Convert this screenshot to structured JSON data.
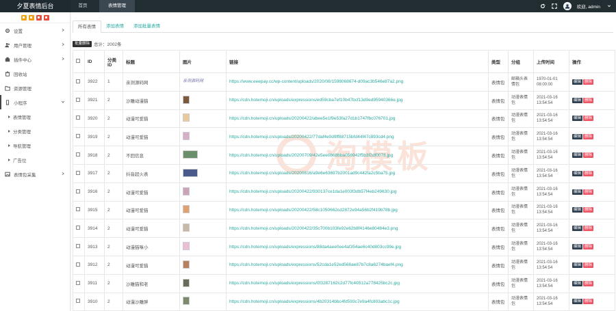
{
  "brand": "夕夏表情后台",
  "nav": {
    "home": "首页",
    "emoji_manage": "表情管理"
  },
  "user": {
    "greeting": "欢迎, admin"
  },
  "colors": {
    "topbar": "#222d32",
    "accent": "#27a9a0",
    "delete": "#ed5565",
    "edit": "#2f4050"
  },
  "quick_buttons": [
    {
      "icon": "home-icon",
      "color": "#f0a30a"
    },
    {
      "icon": "user-icon",
      "color": "#f39c12"
    },
    {
      "icon": "trash-icon",
      "color": "#e74c3c"
    },
    {
      "icon": "gear-icon",
      "color": "#e74c3c"
    }
  ],
  "sidebar": {
    "items": [
      {
        "label": "设置",
        "icon": "gear-icon",
        "has_children": true
      },
      {
        "label": "用户管理",
        "icon": "users-icon",
        "has_children": true
      },
      {
        "label": "插件中心",
        "icon": "plugin-icon",
        "has_children": true
      },
      {
        "label": "回收站",
        "icon": "trash-icon",
        "has_children": false
      },
      {
        "label": "资源管理",
        "icon": "folder-icon",
        "has_children": false
      },
      {
        "label": "小程序",
        "icon": "miniapp-icon",
        "has_children": true
      }
    ],
    "sub_items": [
      "表情管理",
      "分类管理",
      "导航管理",
      "广告位"
    ],
    "last_item": {
      "label": "表情包采集",
      "icon": "image-icon",
      "has_children": true
    }
  },
  "tabs": [
    "所有表情",
    "添加表情",
    "添加批量表情"
  ],
  "toolbar": {
    "batch_delete": "批量删除",
    "total": "总计：2002条"
  },
  "table": {
    "headers": [
      "",
      "ID",
      "分类ID",
      "标题",
      "图片",
      "链接",
      "类型",
      "分组",
      "上传时间",
      "操作"
    ],
    "edit_label": "编辑",
    "delete_label": "删除",
    "rows": [
      {
        "id": "3922",
        "cat": "1",
        "title": "亲测源码网",
        "link": "https://www.eeepay.cc/wp-content/uploads/2020/08/1598068674-d09ac3b546e87a2.png",
        "type": "表情包",
        "group": "邮箱头表情包",
        "time": "1970-01-01 08:00:00",
        "img": "sig",
        "img_text": "亲测源码网",
        "img_color": "#ffffff"
      },
      {
        "id": "3921",
        "cat": "2",
        "title": "沙雕动漫猫",
        "link": "https://cdn.hotemoji.cn/uploads/expressions/ed59cba7ef10b47bcf13d9ed95940366e.jpg",
        "type": "表情包",
        "group": "动漫表情包",
        "time": "2021-03-16 13:54:54",
        "img": "thumb",
        "img_color": "#7a5a3c"
      },
      {
        "id": "3920",
        "cat": "2",
        "title": "动漫可爱猫",
        "link": "https://cdn.hotemoji.cn/uploads/20200422/abee5e1f9e53fa27d1b1747fbc076701.jpg",
        "type": "表情包",
        "group": "动漫表情包",
        "time": "2021-03-16 13:54:54",
        "img": "thumb",
        "img_color": "#e8c9a0"
      },
      {
        "id": "3919",
        "cat": "2",
        "title": "动漫可爱猫",
        "link": "https://cdn.hotemoji.cn/uploads/20200422/77daf4e0d9ff88715bfd44f47c893cd4.png",
        "type": "表情包",
        "group": "动漫表情包",
        "time": "2021-03-16 13:54:54",
        "img": "thumb",
        "img_color": "#d7b0c8"
      },
      {
        "id": "3918",
        "cat": "2",
        "title": "不回信息",
        "link": "https://cdn.hotemoji.cn/uploads/20200709/42e5ee0b68bba056942f5b3f2df0078.jpg",
        "type": "表情包",
        "group": "动漫表情包",
        "time": "2021-03-16 13:54:54",
        "img": "wide",
        "img_color": "#6b8e6b"
      },
      {
        "id": "3917",
        "cat": "2",
        "title": "抖音超火表",
        "link": "https://cdn.hotemoji.cn/uploads/20200816/a9e6e63697b2001ad9c442fa2c5ba75.jpg",
        "type": "表情包",
        "group": "动漫表情包",
        "time": "2021-03-16 13:54:54",
        "img": "wide",
        "img_color": "#4a5a8a"
      },
      {
        "id": "3916",
        "cat": "2",
        "title": "动漫可爱猫",
        "link": "https://cdn.hotemoji.cn/uploads/20200422/930137ce1da1e003f3db57f4eb249630.jpg",
        "type": "表情包",
        "group": "动漫表情包",
        "time": "2021-03-16 13:54:54",
        "img": "thumb",
        "img_color": "#caa4b8"
      },
      {
        "id": "3915",
        "cat": "2",
        "title": "动漫可爱猫",
        "link": "https://cdn.hotemoji.cn/uploads/20200422/58c1050662cd2872e94a56b2f419b78b.jpg",
        "type": "表情包",
        "group": "动漫表情包",
        "time": "2021-03-16 13:54:54",
        "img": "thumb",
        "img_color": "#e0a070"
      },
      {
        "id": "3914",
        "cat": "2",
        "title": "动漫可爱猫",
        "link": "https://cdn.hotemoji.cn/uploads/20200422/35c700b103fe92e62b8f4146e80484e3.png",
        "type": "表情包",
        "group": "动漫表情包",
        "time": "2021-03-16 13:54:54",
        "img": "thumb",
        "img_color": "#c9b9a9"
      },
      {
        "id": "3913",
        "cat": "2",
        "title": "动漫猫咪小",
        "link": "https://cdn.hotemoji.cn/uploads/expressions/88da4aee0ee4af354ae6c40d803cc99e.jpg",
        "type": "表情包",
        "group": "动漫表情包",
        "time": "2021-03-16 13:54:54",
        "img": "thumb",
        "img_color": "#e8c0d8"
      },
      {
        "id": "3912",
        "cat": "2",
        "title": "动漫可爱猫",
        "link": "https://cdn.hotemoji.cn/uploads/expressions/52cda1e52ed566ae87b7c8a6274baef4.png",
        "type": "表情包",
        "group": "动漫表情包",
        "time": "2021-03-16 13:54:54",
        "img": "thumb",
        "img_color": "#b88060"
      },
      {
        "id": "3911",
        "cat": "2",
        "title": "沙雕猫和老",
        "link": "https://cdn.hotemoji.cn/uploads/expressions/0f3287162c2d77fc40512a778425bc2c.jpg",
        "type": "表情包",
        "group": "动漫表情包",
        "time": "2021-03-16 13:54:54",
        "img": "thumb",
        "img_color": "#6a6a5a"
      },
      {
        "id": "3910",
        "cat": "2",
        "title": "动漫沙雕胖",
        "link": "https://cdn.hotemoji.cn/uploads/expressions/4b20314bbc4fd593c7e9a4fc803abc1c.jpg",
        "type": "表情包",
        "group": "动漫表情包",
        "time": "2021-03-16 13:54:54",
        "img": "thumb",
        "img_color": "#7a8a6a"
      }
    ]
  },
  "watermark_text": "淘模板"
}
